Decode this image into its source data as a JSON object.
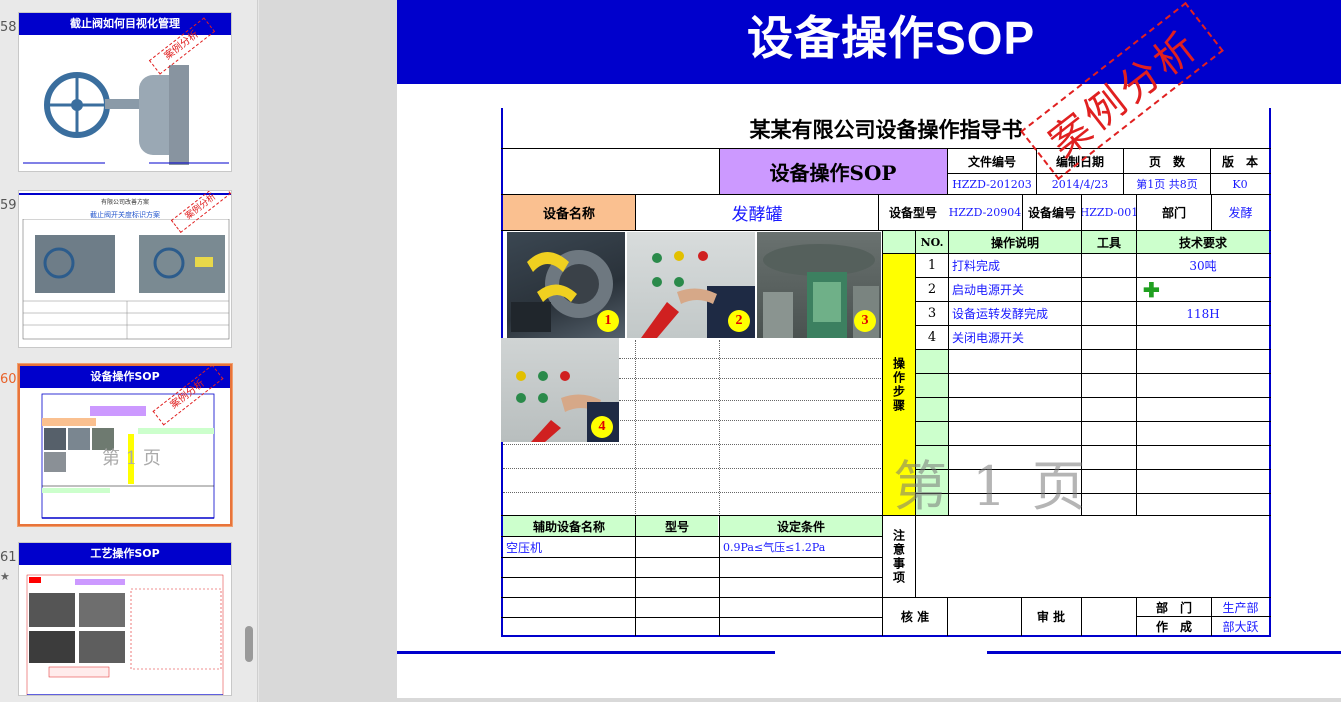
{
  "thumbnails": [
    {
      "number": "58",
      "title": "截止阀如何目视化管理",
      "stamp": "案例分析"
    },
    {
      "number": "59",
      "title": "截止阀开关度标识方案",
      "header": "有限公司改善方案",
      "stamp": "案例分析"
    },
    {
      "number": "60",
      "title": "设备操作SOP",
      "stamp": "案例分析",
      "active": true
    },
    {
      "number": "61",
      "title": "工艺操作SOP"
    }
  ],
  "slide": {
    "title": "设备操作SOP",
    "stamp": "案例分析",
    "page_watermark": "第 1 页"
  },
  "doc": {
    "company_title": "某某有限公司设备操作指导书",
    "sop_label": "设备操作SOP",
    "header_labels": {
      "file_no": "文件编号",
      "date": "编制日期",
      "pages": "页　数",
      "version": "版　本"
    },
    "header_values": {
      "file_no": "HZZD-201203",
      "date": "2014/4/23",
      "pages": "第1页 共8页",
      "version": "K0"
    },
    "equip_name_label": "设备名称",
    "equip_name": "发酵罐",
    "equip_model_label": "设备型号",
    "equip_model": "HZZD-20904",
    "equip_no_label": "设备编号",
    "equip_no": "HZZD-001",
    "dept_label": "部门",
    "dept": "发酵",
    "steps_header": {
      "no": "NO.",
      "desc": "操作说明",
      "tool": "工具",
      "req": "技术要求"
    },
    "steps_side_label": "操作步骤",
    "steps": [
      {
        "no": "1",
        "desc": "打料完成",
        "tool": "",
        "req": "30吨"
      },
      {
        "no": "2",
        "desc": "启动电源开关",
        "tool": "",
        "req": "✚"
      },
      {
        "no": "3",
        "desc": "设备运转发酵完成",
        "tool": "",
        "req": "118H"
      },
      {
        "no": "4",
        "desc": "关闭电源开关",
        "tool": "",
        "req": ""
      }
    ],
    "photo_badges": [
      "1",
      "2",
      "3",
      "4"
    ],
    "aux_header": {
      "name": "辅助设备名称",
      "model": "型号",
      "cond": "设定条件"
    },
    "aux_rows": [
      {
        "name": "空压机",
        "model": "",
        "cond": "0.9Pa≤气压≤1.2Pa"
      }
    ],
    "notes_label": "注意事项",
    "sign": {
      "approve": "核 准",
      "review": "审 批",
      "dept_label": "部　门",
      "dept_value": "生产部",
      "author_label": "作　成",
      "author_value": "部大跃"
    }
  },
  "colors": {
    "header_blue": "#0000cc",
    "stamp_red": "#e02020",
    "table_green": "#ccffcc",
    "table_purple": "#cc99ff",
    "table_orange": "#fac090",
    "side_yellow": "#ffff00"
  }
}
